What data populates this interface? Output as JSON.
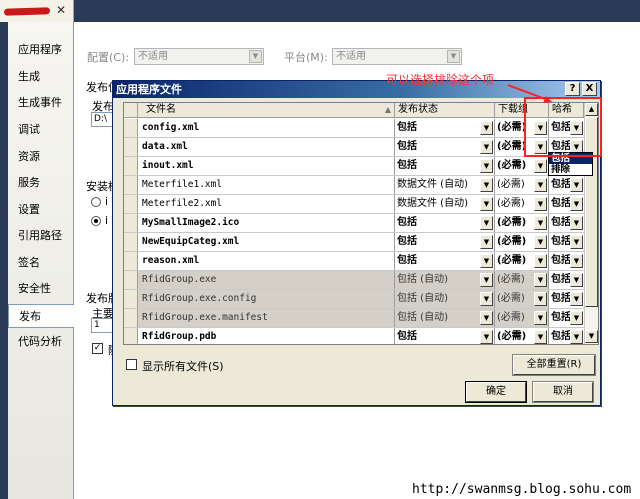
{
  "left_nav": {
    "items": [
      {
        "label": "应用程序"
      },
      {
        "label": "生成"
      },
      {
        "label": "生成事件"
      },
      {
        "label": "调试"
      },
      {
        "label": "资源"
      },
      {
        "label": "服务"
      },
      {
        "label": "设置"
      },
      {
        "label": "引用路径"
      },
      {
        "label": "签名"
      },
      {
        "label": "安全性"
      },
      {
        "label": "发布"
      },
      {
        "label": "代码分析"
      }
    ],
    "active_index": 10
  },
  "page": {
    "config_label": "配置(C):",
    "config_value": "不适用",
    "platform_label": "平台(M):",
    "platform_value": "不适用",
    "publish_loc_label": "发布位",
    "publish_sub_label": "发布",
    "publish_box_value": "D:\\",
    "install_label": "安装模",
    "radio1_text": "i",
    "radio2_text": "i",
    "publish_ver_label": "发布版",
    "major_label": "主要",
    "major_value": "1",
    "auto_inc_text": "随"
  },
  "dialog": {
    "title": "应用程序文件",
    "help_button": "?",
    "close_button": "X",
    "columns": {
      "name": "文件名",
      "status": "发布状态",
      "download": "下载组",
      "hash": "哈希"
    },
    "rows": [
      {
        "name": "config.xml",
        "status": "包括",
        "download": "(必需)",
        "hash": "包括",
        "bold": true
      },
      {
        "name": "data.xml",
        "status": "包括",
        "download": "(必需)",
        "hash": "包括",
        "bold": true
      },
      {
        "name": "inout.xml",
        "status": "包括",
        "download": "(必需)",
        "hash": "包括",
        "bold": true
      },
      {
        "name": "Meterfile1.xml",
        "status": "数据文件 (自动)",
        "download": "(必需)",
        "hash": "包括",
        "bold": false
      },
      {
        "name": "Meterfile2.xml",
        "status": "数据文件 (自动)",
        "download": "(必需)",
        "hash": "包括",
        "bold": false
      },
      {
        "name": "MySmallImage2.ico",
        "status": "包括",
        "download": "(必需)",
        "hash": "包括",
        "bold": true
      },
      {
        "name": "NewEquipCateg.xml",
        "status": "包括",
        "download": "(必需)",
        "hash": "包括",
        "bold": true
      },
      {
        "name": "reason.xml",
        "status": "包括",
        "download": "(必需)",
        "hash": "包括",
        "bold": true
      },
      {
        "name": "RfidGroup.exe",
        "status": "包括 (自动)",
        "download": "(必需)",
        "hash": "包括",
        "bold": false,
        "gray": true
      },
      {
        "name": "RfidGroup.exe.config",
        "status": "包括 (自动)",
        "download": "(必需)",
        "hash": "包括",
        "bold": false,
        "gray": true
      },
      {
        "name": "RfidGroup.exe.manifest",
        "status": "包括 (自动)",
        "download": "(必需)",
        "hash": "包括",
        "bold": false,
        "gray": true
      },
      {
        "name": "RfidGroup.pdb",
        "status": "包括",
        "download": "(必需)",
        "hash": "包括",
        "bold": true
      }
    ],
    "dropdown_options": [
      "包括",
      "排除"
    ],
    "dropdown_highlight_index": 0,
    "show_all_label": "显示所有文件(S)",
    "reset_all_label": "全部重置(R)",
    "ok_label": "确定",
    "cancel_label": "取消"
  },
  "annotation": {
    "text": "可以选择排除这个项",
    "color": "#ff2020"
  },
  "watermark": {
    "text": "http://swanmsg.blog.sohu.com"
  },
  "colors": {
    "titlebar_start": "#0a246a",
    "titlebar_end": "#a6caf0",
    "dialog_bg": "#ece9d8",
    "annotation_red": "#ff2020"
  }
}
